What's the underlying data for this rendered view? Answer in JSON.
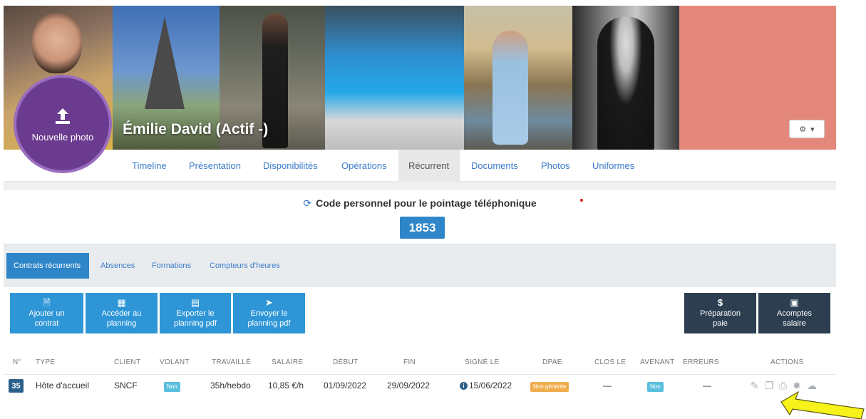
{
  "profile": {
    "new_photo_label": "Nouvelle photo",
    "name": "Émilie David (Actif -)",
    "settings_caret": "▾"
  },
  "tabs": [
    {
      "label": "Timeline",
      "active": false
    },
    {
      "label": "Présentation",
      "active": false
    },
    {
      "label": "Disponibilités",
      "active": false
    },
    {
      "label": "Opérations",
      "active": false
    },
    {
      "label": "Récurrent",
      "active": true
    },
    {
      "label": "Documents",
      "active": false
    },
    {
      "label": "Photos",
      "active": false
    },
    {
      "label": "Uniformes",
      "active": false
    }
  ],
  "code": {
    "title": "Code personnel pour le pointage téléphonique",
    "value": "1853"
  },
  "subtabs": [
    {
      "label": "Contrats récurrents",
      "active": true
    },
    {
      "label": "Absences",
      "active": false
    },
    {
      "label": "Formations",
      "active": false
    },
    {
      "label": "Compteurs d'heures",
      "active": false
    }
  ],
  "buttons": {
    "add_contract": {
      "line1": "Ajouter un",
      "line2": "contrat"
    },
    "planning": {
      "line1": "Accéder au",
      "line2": "planning"
    },
    "export_pdf": {
      "line1": "Exporter le",
      "line2": "planning pdf"
    },
    "send_pdf": {
      "line1": "Envoyer le",
      "line2": "planning pdf"
    },
    "payroll": {
      "icon": "$",
      "line1": "Préparation",
      "line2": "paie"
    },
    "advances": {
      "line1": "Acomptes",
      "line2": "salaire"
    }
  },
  "table": {
    "headers": [
      "N°",
      "TYPE",
      "CLIENT",
      "VOLANT",
      "TRAVAILLÉ",
      "SALAIRE",
      "DÉBUT",
      "FIN",
      "SIGNÉ LE",
      "DPAE",
      "CLOS LE",
      "AVENANT",
      "ERREURS",
      "ACTIONS"
    ],
    "rows": [
      {
        "num": "35",
        "type": "Hôte d'accueil",
        "client": "SNCF",
        "volant": "Non",
        "travaille": "35h/hebdo",
        "salaire": "10,85 €/h",
        "debut": "01/09/2022",
        "fin": "29/09/2022",
        "signe_le": "15/06/2022",
        "dpae": "Non générée",
        "clos_le": "—",
        "avenant": "Non",
        "erreurs": "—"
      }
    ]
  },
  "colors": {
    "primary": "#2e96d7",
    "dark": "#2c3e50",
    "avatar": "#6a3b8e",
    "cover_block": "#e4887c",
    "arrow": "#f6f21a"
  },
  "icons": {
    "upload": "upload-icon",
    "refresh": "refresh-icon",
    "gears": "gears-icon",
    "file": "file-icon",
    "calendar": "calendar-icon",
    "pdf": "pdf-icon",
    "send": "paper-plane-icon",
    "money": "money-icon",
    "info": "info-icon",
    "pencil": "pencil-icon",
    "copy": "copy-icon",
    "print": "print-icon",
    "cog": "cog-icon",
    "cloud": "cloud-upload-icon"
  }
}
